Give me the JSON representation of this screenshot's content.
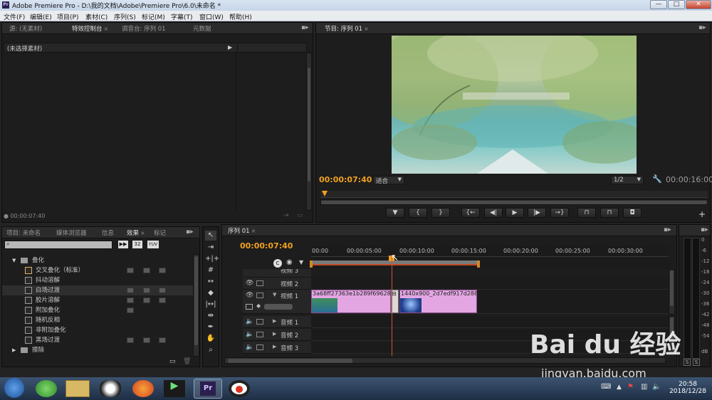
{
  "window": {
    "app_icon_text": "Pr",
    "title": "Adobe Premiere Pro - D:\\我的文档\\Adobe\\Premiere Pro\\6.0\\未命名 *",
    "min": "—",
    "max": "□",
    "close": "✕"
  },
  "menu": [
    "文件(F)",
    "编辑(E)",
    "项目(P)",
    "素材(C)",
    "序列(S)",
    "标记(M)",
    "字幕(T)",
    "窗口(W)",
    "帮助(H)"
  ],
  "source_panel": {
    "tabs": [
      "源: (无素材)",
      "特效控制台",
      "调音台: 序列 01",
      "元数据"
    ],
    "no_clip_label": "(未选择素材)",
    "timecode": "00:00:07:40"
  },
  "program_monitor": {
    "tab": "节目: 序列 01",
    "current_time": "00:00:07:40",
    "fit_option": "适合",
    "resolution": "1/2",
    "duration": "00:00:16:00",
    "playhead_fraction": 0.02
  },
  "project_panel": {
    "tabs": [
      "项目: 未命名",
      "媒体浏览器",
      "信息",
      "效果",
      "标记"
    ],
    "search_placeholder": "",
    "badge_32": "32",
    "badge_yuv": "YUV",
    "folder": "叠化",
    "items": [
      "交叉叠化（标准）",
      "抖动溶解",
      "白场过渡",
      "胶片溶解",
      "附加叠化",
      "随机反相",
      "非附加叠化",
      "黑场过渡"
    ],
    "next_folder": "擦除"
  },
  "timeline": {
    "tab": "序列 01",
    "current_time": "00:00:07:40",
    "ruler": [
      "00:00",
      "00:00:05:00",
      "00:00:10:00",
      "00:00:15:00",
      "00:00:20:00",
      "00:00:25:00",
      "00:00:30:00"
    ],
    "tracks": {
      "video3": "视频 3",
      "video2": "视频 2",
      "video1": "视频 1",
      "audio1": "音频 1",
      "audio2": "音频 2",
      "audio3": "音频 3"
    },
    "clip1_name": "3a68ff27363e1b289f69628c7",
    "clip2_name": "1440x900_2d7edf917d28899"
  },
  "audio_meter": {
    "labels": [
      "0",
      "-6",
      "-12",
      "-18",
      "-24",
      "-30",
      "-36",
      "-42",
      "-48",
      "-54",
      "dB"
    ],
    "solo": "S"
  },
  "taskbar": {
    "time": "20:58",
    "date": "2018/12/28"
  },
  "watermark": {
    "brand": "Bai du 经验",
    "url": "jingyan.baidu.com"
  },
  "colors": {
    "accent_time": "#f0a020",
    "clip_pink": "#e3a6e3",
    "work_area": "#d08a2a"
  }
}
